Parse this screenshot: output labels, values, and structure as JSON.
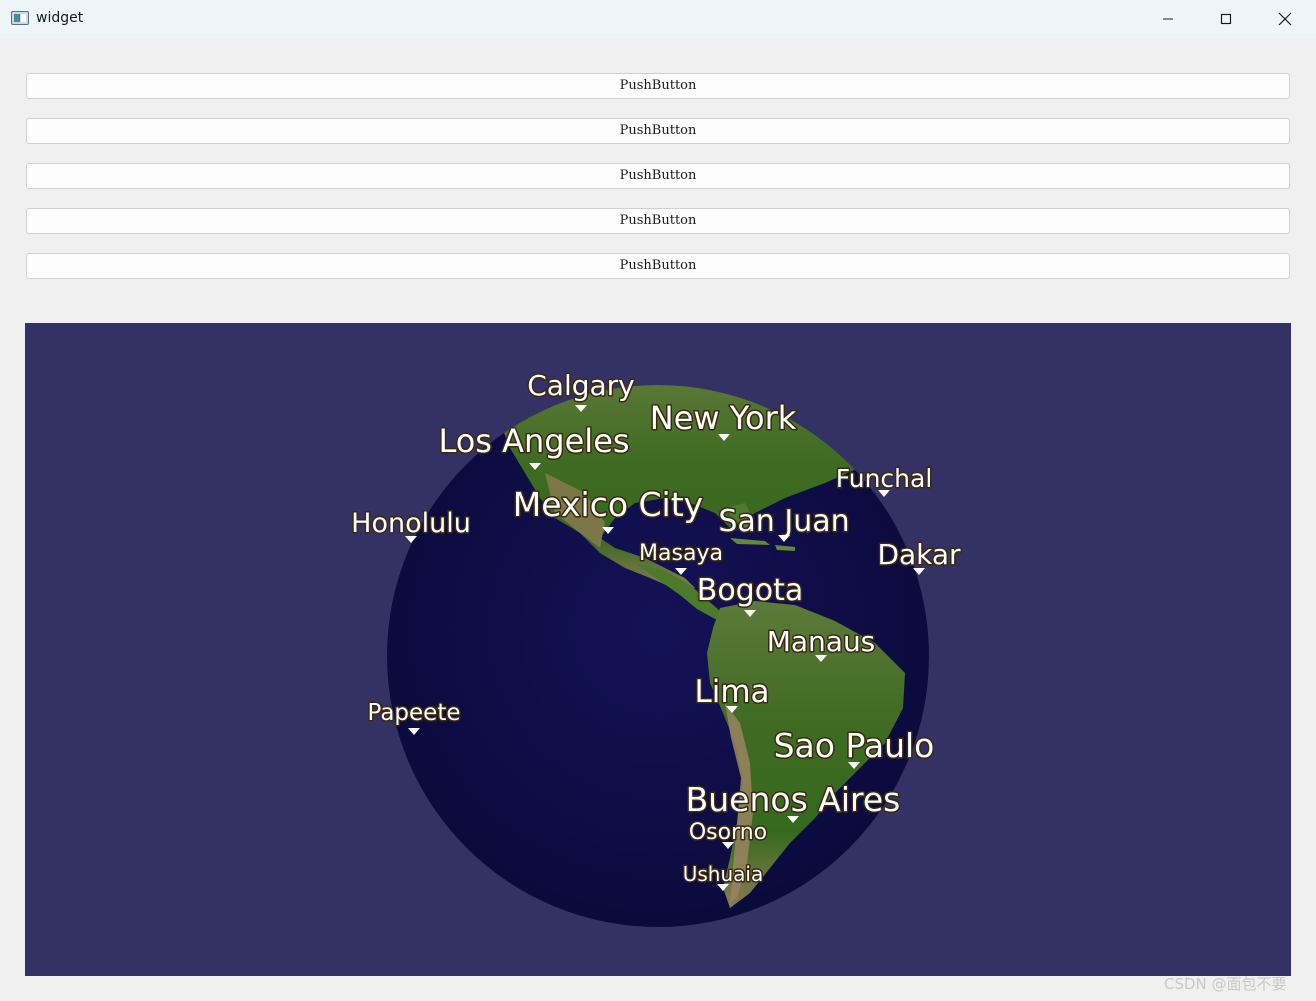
{
  "window": {
    "title": "widget",
    "icon": "app-window-icon",
    "controls": {
      "minimize": "minimize-icon",
      "maximize": "maximize-icon",
      "close": "close-icon"
    }
  },
  "buttons": [
    {
      "label": "PushButton"
    },
    {
      "label": "PushButton"
    },
    {
      "label": "PushButton"
    },
    {
      "label": "PushButton"
    },
    {
      "label": "PushButton"
    }
  ],
  "map": {
    "background_color": "#343264",
    "ocean_color": "#0e0d46",
    "land_color": "#466a2c",
    "cities": [
      {
        "name": "Calgary"
      },
      {
        "name": "New York"
      },
      {
        "name": "Los Angeles"
      },
      {
        "name": "Funchal"
      },
      {
        "name": "Honolulu"
      },
      {
        "name": "Mexico City"
      },
      {
        "name": "San Juan"
      },
      {
        "name": "Masaya"
      },
      {
        "name": "Dakar"
      },
      {
        "name": "Bogota"
      },
      {
        "name": "Manaus"
      },
      {
        "name": "Lima"
      },
      {
        "name": "Papeete"
      },
      {
        "name": "Sao Paulo"
      },
      {
        "name": "Buenos Aires"
      },
      {
        "name": "Osorno"
      },
      {
        "name": "Ushuaia"
      }
    ]
  },
  "watermark": "CSDN @面包不要"
}
